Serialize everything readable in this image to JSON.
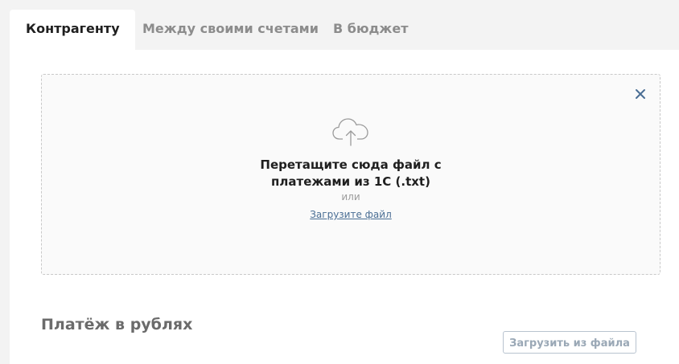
{
  "tabs": [
    {
      "label": "Контрагенту",
      "active": true
    },
    {
      "label": "Между своими счетами",
      "active": false
    },
    {
      "label": "В бюджет",
      "active": false
    }
  ],
  "dropzone": {
    "title_line1": "Перетащите сюда файл с",
    "title_line2": "платежами из 1С (.txt)",
    "or_text": "или",
    "upload_link": "Загрузите файл",
    "upload_icon": "cloud-upload-icon",
    "close_icon": "close-icon"
  },
  "section": {
    "title": "Платёж в рублях",
    "upload_button": "Загрузить из файла"
  },
  "colors": {
    "page_bg": "#f3f3f3",
    "panel_bg": "#ffffff",
    "dropzone_bg": "#fafafa",
    "link": "#4a6e94",
    "close": "#4a6e94"
  }
}
